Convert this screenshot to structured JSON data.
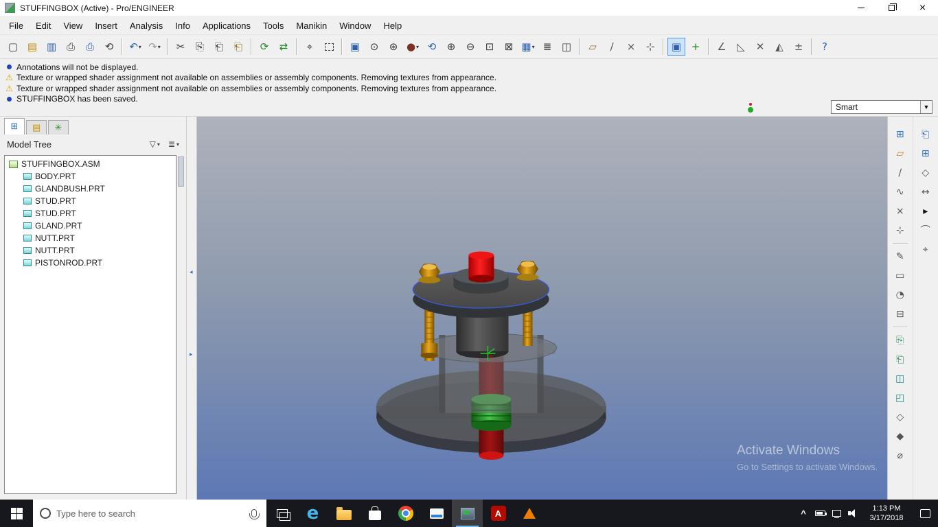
{
  "window": {
    "title": "STUFFINGBOX (Active) - Pro/ENGINEER",
    "controls": [
      {
        "name": "minimize-button",
        "kind": "min"
      },
      {
        "name": "restore-button",
        "kind": "max"
      },
      {
        "name": "close-button",
        "kind": "close",
        "glyph": "×"
      }
    ]
  },
  "menus": [
    "File",
    "Edit",
    "View",
    "Insert",
    "Analysis",
    "Info",
    "Applications",
    "Tools",
    "Manikin",
    "Window",
    "Help"
  ],
  "toolbar": {
    "items": [
      {
        "name": "new-file",
        "glyph": "▢",
        "color": "#3a3a3a"
      },
      {
        "name": "open-file",
        "glyph": "▤",
        "color": "#c28a00"
      },
      {
        "name": "save",
        "glyph": "▥",
        "color": "#2b5fb0"
      },
      {
        "name": "print",
        "glyph": "⎙",
        "color": "#3a3a3a"
      },
      {
        "name": "print-preview",
        "glyph": "⎙",
        "color": "#2b5fb0"
      },
      {
        "name": "erase-display",
        "glyph": "⟲",
        "color": "#3a3a3a"
      },
      {
        "name": "undo",
        "glyph": "↶",
        "color": "#2b5fb0",
        "dd": true,
        "sep": true
      },
      {
        "name": "redo",
        "glyph": "↷",
        "color": "#9a9a9a",
        "dd": true
      },
      {
        "name": "cut",
        "glyph": "✂",
        "color": "#3a3a3a",
        "sep": true
      },
      {
        "name": "copy",
        "glyph": "⎘",
        "color": "#3a3a3a"
      },
      {
        "name": "paste",
        "glyph": "⎗",
        "color": "#3a3a3a"
      },
      {
        "name": "paste-special",
        "glyph": "⎗",
        "color": "#8a6a00"
      },
      {
        "name": "regenerate",
        "glyph": "⟳",
        "color": "#1d8a1d",
        "sep": true
      },
      {
        "name": "custom-regenerate",
        "glyph": "⇄",
        "color": "#1d8a1d"
      },
      {
        "name": "find",
        "glyph": "⌖",
        "color": "#3a3a3a",
        "sep": true
      },
      {
        "name": "select-region",
        "dashed": true
      },
      {
        "name": "display-filter",
        "glyph": "▣",
        "color": "#2b5fb0",
        "sep": true
      },
      {
        "name": "pick-filter",
        "glyph": "⊙",
        "color": "#3a3a3a"
      },
      {
        "name": "orient-mode",
        "glyph": "⊛",
        "color": "#3a3a3a"
      },
      {
        "name": "display-style",
        "glyph": "●",
        "color": "#7a3322",
        "dd": true
      },
      {
        "name": "spin-view",
        "glyph": "⟲",
        "color": "#2b5fb0"
      },
      {
        "name": "zoom-in",
        "glyph": "⊕",
        "color": "#3a3a3a"
      },
      {
        "name": "zoom-out",
        "glyph": "⊖",
        "color": "#3a3a3a"
      },
      {
        "name": "refit",
        "glyph": "⊡",
        "color": "#3a3a3a"
      },
      {
        "name": "reorient",
        "glyph": "⊠",
        "color": "#3a3a3a"
      },
      {
        "name": "saved-views",
        "glyph": "▦",
        "color": "#2b5fb0",
        "dd": true
      },
      {
        "name": "layers",
        "glyph": "≣",
        "color": "#3a3a3a"
      },
      {
        "name": "view-manager",
        "glyph": "◫",
        "color": "#3a3a3a"
      },
      {
        "name": "datum-planes-toggle",
        "glyph": "▱",
        "color": "#8a6a30",
        "sep": true
      },
      {
        "name": "datum-axes-toggle",
        "glyph": "∕",
        "color": "#555555"
      },
      {
        "name": "datum-points-toggle",
        "glyph": "×",
        "color": "#555555"
      },
      {
        "name": "datum-csys-toggle",
        "glyph": "⊹",
        "color": "#555555"
      },
      {
        "name": "annotations-toggle",
        "glyph": "▣",
        "color": "#2b5fb0",
        "active": true,
        "sep": true
      },
      {
        "name": "spin-center-toggle",
        "glyph": "+",
        "color": "#1d8a1d"
      },
      {
        "name": "designate-dims",
        "glyph": "∠",
        "color": "#555555",
        "sep": true
      },
      {
        "name": "annotation-orient",
        "glyph": "◺",
        "color": "#555555"
      },
      {
        "name": "note-display",
        "glyph": "✕",
        "color": "#555555"
      },
      {
        "name": "symbol-display",
        "glyph": "◭",
        "color": "#555555"
      },
      {
        "name": "tolerance-display",
        "glyph": "±",
        "color": "#555555"
      },
      {
        "name": "context-help",
        "glyph": "?",
        "color": "#2b5fb0",
        "sep": true
      }
    ]
  },
  "messages": {
    "items": [
      {
        "icon": "info",
        "text": "Annotations will not be displayed."
      },
      {
        "icon": "warning",
        "text": "Texture or wrapped shader assignment not available on assemblies or assembly components. Removing textures from appearance."
      },
      {
        "icon": "warning",
        "text": "Texture or wrapped shader assignment not available on assemblies or assembly components. Removing textures from appearance."
      },
      {
        "icon": "info",
        "text": "STUFFINGBOX has been saved."
      }
    ]
  },
  "selection_filter": {
    "value": "Smart"
  },
  "left_panel": {
    "tabs": [
      {
        "name": "model-tree-tab",
        "glyph": "⊞",
        "color": "#3b6fc4",
        "active": true
      },
      {
        "name": "folder-browser-tab",
        "glyph": "▤",
        "color": "#c99700"
      },
      {
        "name": "favorites-tab",
        "glyph": "✳",
        "color": "#2e8b2e"
      }
    ],
    "header": {
      "title": "Model Tree",
      "buttons": [
        {
          "name": "tree-filters-button",
          "glyph": "▽"
        },
        {
          "name": "tree-settings-button",
          "glyph": "≣"
        }
      ]
    },
    "tree": {
      "root": {
        "label": "STUFFINGBOX.ASM"
      },
      "items": [
        {
          "label": "BODY.PRT"
        },
        {
          "label": "GLANDBUSH.PRT"
        },
        {
          "label": "STUD.PRT"
        },
        {
          "label": "STUD.PRT"
        },
        {
          "label": "GLAND.PRT"
        },
        {
          "label": "NUTT.PRT"
        },
        {
          "label": "NUTT.PRT"
        },
        {
          "label": "PISTONROD.PRT"
        }
      ]
    }
  },
  "viewport": {
    "watermark": {
      "line1": "Activate Windows",
      "line2": "Go to Settings to activate Windows."
    },
    "colors": {
      "piston_rod": "#8b1212",
      "rod_cap": "#cf1212",
      "gland_body": "#4a4d50",
      "studs": "#d99a18",
      "packing": "#35a838",
      "selection_outline": "#3a5bd9"
    }
  },
  "right_toolbar": {
    "columns": [
      {
        "items": [
          {
            "name": "window-activate-tool",
            "glyph": "⊞",
            "color": "#2e6fbe"
          },
          {
            "name": "datum-plane-tool",
            "glyph": "▱",
            "color": "#c77b29"
          },
          {
            "name": "datum-axis-tool",
            "glyph": "∕",
            "color": "#555555"
          },
          {
            "name": "datum-curve-tool",
            "glyph": "∿",
            "color": "#555555"
          },
          {
            "name": "datum-point-tool",
            "glyph": "×",
            "color": "#555555"
          },
          {
            "name": "datum-csys-tool",
            "glyph": "⊹",
            "color": "#555555"
          },
          {
            "sep": true
          },
          {
            "name": "sketch-tool",
            "glyph": "✎",
            "color": "#555555"
          },
          {
            "name": "annotation-feature-tool",
            "glyph": "▭",
            "color": "#555555"
          },
          {
            "name": "round-tool",
            "glyph": "◔",
            "color": "#555555"
          },
          {
            "name": "hole-tool",
            "glyph": "⊟",
            "color": "#555555"
          },
          {
            "sep": true
          },
          {
            "name": "copy-geometry-tool",
            "glyph": "⎘",
            "color": "#2e8b57"
          },
          {
            "name": "publish-geometry-tool",
            "glyph": "⎗",
            "color": "#2e8b57"
          },
          {
            "name": "shrinkwrap-tool",
            "glyph": "◫",
            "color": "#1f8a8a"
          },
          {
            "name": "merge-tool",
            "glyph": "◰",
            "color": "#1f8a8a"
          },
          {
            "name": "pattern-tool",
            "glyph": "◇",
            "color": "#555555"
          },
          {
            "name": "mirror-tool",
            "glyph": "◆",
            "color": "#555555"
          },
          {
            "name": "measure-tool",
            "glyph": "⌀",
            "color": "#555555"
          }
        ]
      },
      {
        "items": [
          {
            "name": "assemble-component-tool",
            "glyph": "⎗",
            "color": "#2e6fbe"
          },
          {
            "name": "create-component-tool",
            "glyph": "⊞",
            "color": "#2e6fbe"
          },
          {
            "name": "repeat-component-tool",
            "glyph": "◇",
            "color": "#555555"
          },
          {
            "name": "drag-component-tool",
            "glyph": "↔",
            "color": "#555555"
          },
          {
            "name": "expand-toolbar-arrow",
            "glyph": "▸",
            "color": "#111111"
          },
          {
            "name": "mechanism-drag-tool",
            "glyph": "⌒",
            "color": "#555555"
          },
          {
            "name": "component-interface-tool",
            "glyph": "⌖",
            "color": "#555555"
          }
        ]
      }
    ]
  },
  "taskbar": {
    "search_placeholder": "Type here to search",
    "apps": [
      {
        "name": "task-view-button",
        "kind": "tview"
      },
      {
        "name": "edge-browser",
        "kind": "glyph",
        "glyph": "e",
        "color": "#46b4e8",
        "size": 26,
        "bold": true
      },
      {
        "name": "file-explorer",
        "kind": "folder"
      },
      {
        "name": "microsoft-store",
        "kind": "store"
      },
      {
        "name": "chrome-browser",
        "kind": "chrome"
      },
      {
        "name": "display-app",
        "kind": "monitor"
      },
      {
        "name": "proengineer-app",
        "kind": "proe",
        "active": true
      },
      {
        "name": "acrobat-reader",
        "kind": "acro",
        "glyph": "A"
      },
      {
        "name": "vlc-player",
        "kind": "cone"
      }
    ],
    "tray": [
      {
        "name": "hidden-icons-chevron",
        "kind": "glyph",
        "glyph": "^"
      },
      {
        "name": "battery-icon",
        "kind": "battery"
      },
      {
        "name": "network-icon",
        "kind": "pc"
      },
      {
        "name": "volume-icon",
        "kind": "speaker"
      }
    ],
    "time": "1:13 PM",
    "date": "3/17/2018"
  }
}
